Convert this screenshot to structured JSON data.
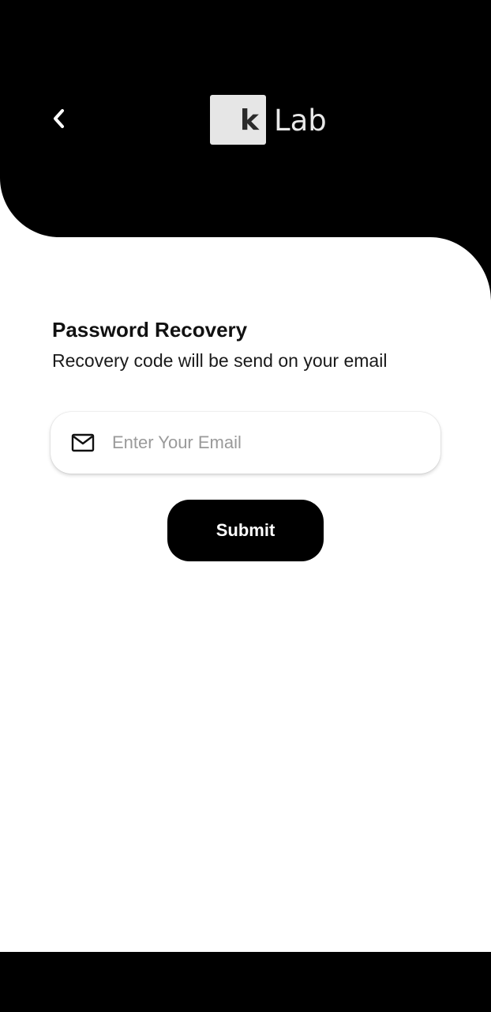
{
  "header": {
    "back_icon": "chevron-left-icon",
    "logo_letter": "k",
    "logo_word": "Lab",
    "background_color": "#000000"
  },
  "form": {
    "title": "Password Recovery",
    "subtitle": "Recovery code will be send on your email",
    "email": {
      "icon": "mail-icon",
      "placeholder": "Enter Your Email",
      "value": ""
    },
    "submit_label": "Submit"
  },
  "colors": {
    "primary": "#000000",
    "background": "#ffffff",
    "placeholder": "#9a9a9a",
    "logo_box": "#e6e6e6"
  }
}
